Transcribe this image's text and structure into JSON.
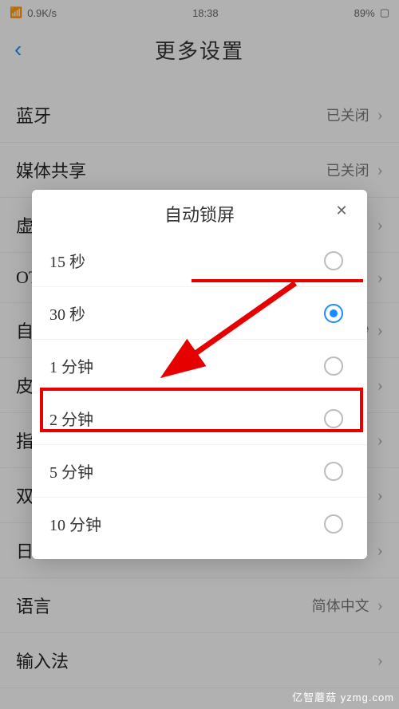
{
  "status": {
    "left": "0.9K/s",
    "center": "18:38",
    "right": "89%"
  },
  "nav": {
    "title": "更多设置"
  },
  "rows": [
    {
      "label": "蓝牙",
      "value": "已关闭"
    },
    {
      "label": "媒体共享",
      "value": "已关闭"
    },
    {
      "label": "虚拟",
      "value": ""
    },
    {
      "label": "OTG",
      "value": ""
    },
    {
      "label": "自动锁屏",
      "value": "30秒"
    },
    {
      "label": "皮肤",
      "value": ""
    },
    {
      "label": "指纹",
      "value": ""
    },
    {
      "label": "双击",
      "value": ""
    },
    {
      "label": "日期和时间",
      "value": ""
    },
    {
      "label": "语言",
      "value": "简体中文"
    },
    {
      "label": "输入法",
      "value": ""
    }
  ],
  "dialog": {
    "title": "自动锁屏",
    "options": [
      {
        "label": "15 秒",
        "selected": false
      },
      {
        "label": "30 秒",
        "selected": true
      },
      {
        "label": "1 分钟",
        "selected": false
      },
      {
        "label": "2 分钟",
        "selected": false
      },
      {
        "label": "5 分钟",
        "selected": false
      },
      {
        "label": "10 分钟",
        "selected": false
      }
    ]
  },
  "annotation": {
    "arrow_color": "#e60000",
    "highlight_option_index": 3
  },
  "watermark": "亿智蘑菇  yzmg.com"
}
